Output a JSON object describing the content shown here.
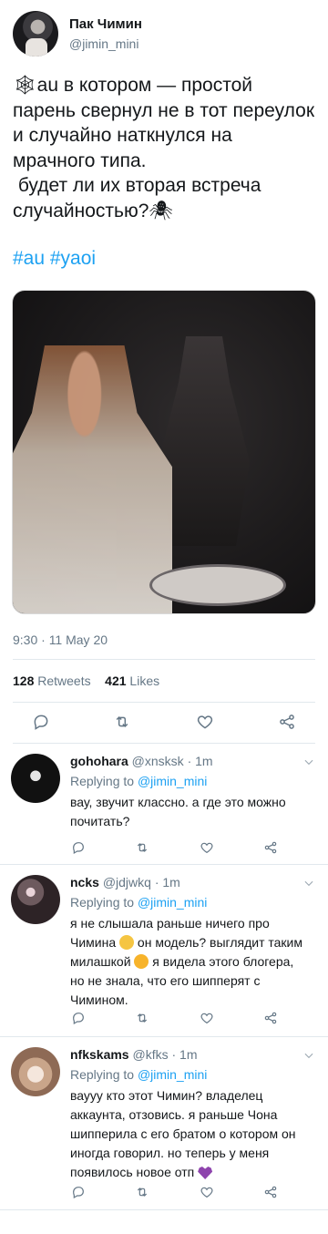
{
  "tweet": {
    "author_name": "Пак Чимин",
    "author_handle": "@jimin_mini",
    "text": "🕸au в котором — простой парень свернул не в тот переулок и случайно наткнулся на мрачного типа.\n будет ли их вторая встреча случайностью?🕷",
    "hashtags": "#au #yaoi",
    "timestamp": "9:30 · 11 May 20",
    "retweets_count": "128",
    "retweets_label": "Retweets",
    "likes_count": "421",
    "likes_label": "Likes"
  },
  "replies": [
    {
      "name": "gohohara",
      "handle": "@xnsksk",
      "time": "· 1m",
      "replying_prefix": "Replying to",
      "replying_to": "@jimin_mini",
      "text": "вау, звучит классно. а где это можно почитать?"
    },
    {
      "name": "ncks",
      "handle": "@jdjwkq",
      "time": "· 1m",
      "replying_prefix": "Replying to",
      "replying_to": "@jimin_mini",
      "text_parts": [
        "я не слышала раньше ничего про Чимина",
        " он модель? выглядит таким милашкой",
        " я видела этого блогера, но не знала, что его шипперят с Чимином."
      ]
    },
    {
      "name": "nfkskams",
      "handle": "@kfks",
      "time": "· 1m",
      "replying_prefix": "Replying to",
      "replying_to": "@jimin_mini",
      "text": "вауyy кто этот Чимин? владелец аккаунта, отзовись. я раньше Чона шипперила с его братом о котором он иногда говорил. но теперь у меня появилось новое отп"
    }
  ],
  "icons": {
    "reply": "reply-icon",
    "retweet": "retweet-icon",
    "like": "heart-icon",
    "share": "share-icon",
    "more": "chevron-down-icon"
  },
  "colors": {
    "link": "#1da1f2",
    "secondary_text": "#657786",
    "divider": "#e1e8ed"
  }
}
